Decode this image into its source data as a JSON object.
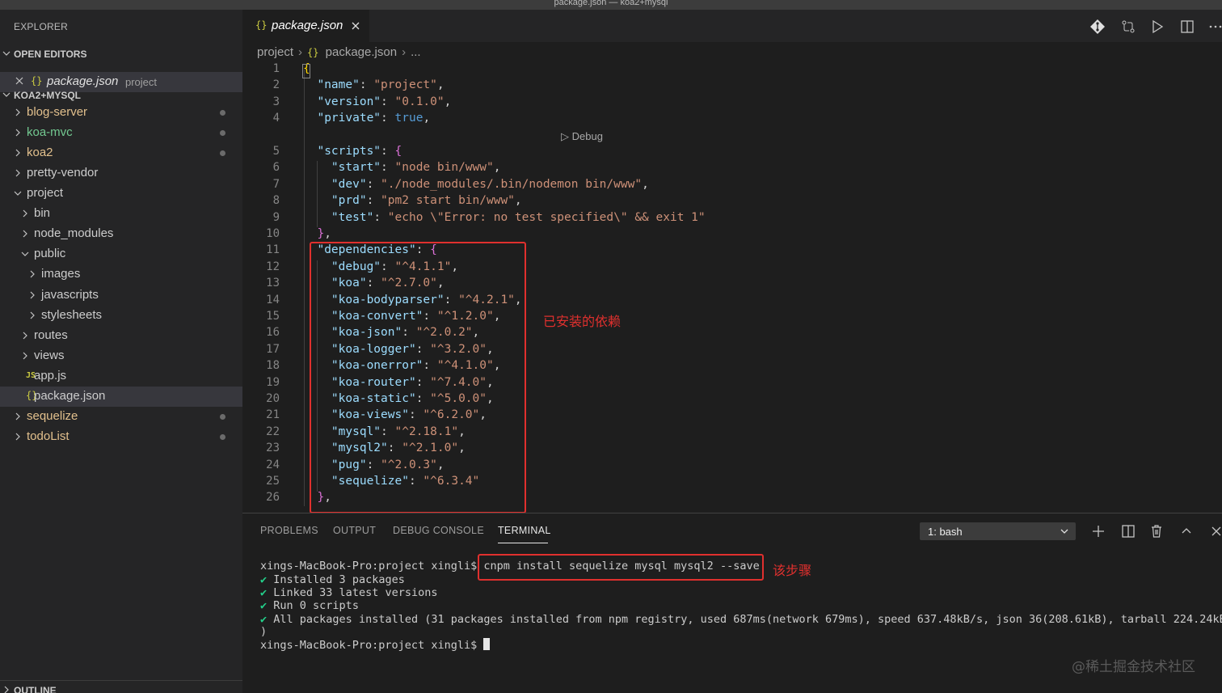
{
  "window": {
    "title": "package.json — koa2+mysql"
  },
  "sidebar": {
    "header": "EXPLORER",
    "open_editors": {
      "title": "OPEN EDITORS",
      "items": [
        {
          "name": "package.json",
          "description": "project"
        }
      ]
    },
    "workspace": {
      "title": "KOA2+MYSQL",
      "items": [
        {
          "label": "blog-server",
          "color": "#e2c08d",
          "modified": true
        },
        {
          "label": "koa-mvc",
          "color": "#73c991",
          "modified": true
        },
        {
          "label": "koa2",
          "color": "#e2c08d",
          "modified": true
        },
        {
          "label": "pretty-vendor",
          "color": "#cccccc"
        },
        {
          "label": "project",
          "color": "#cccccc",
          "expanded": true
        },
        {
          "label": "bin",
          "color": "#cccccc"
        },
        {
          "label": "node_modules",
          "color": "#cccccc"
        },
        {
          "label": "public",
          "color": "#cccccc",
          "expanded": true
        },
        {
          "label": "images",
          "color": "#cccccc"
        },
        {
          "label": "javascripts",
          "color": "#cccccc"
        },
        {
          "label": "stylesheets",
          "color": "#cccccc"
        },
        {
          "label": "routes",
          "color": "#cccccc"
        },
        {
          "label": "views",
          "color": "#cccccc"
        },
        {
          "label": "app.js",
          "color": "#cccccc",
          "icon": "JS"
        },
        {
          "label": "package.json",
          "color": "#cccccc",
          "icon": "{}",
          "selected": true
        },
        {
          "label": "sequelize",
          "color": "#e2c08d",
          "modified": true
        },
        {
          "label": "todoList",
          "color": "#e2c08d",
          "modified": true
        }
      ]
    },
    "outline": "OUTLINE"
  },
  "editor": {
    "tab": {
      "icon": "{}",
      "label": "package.json"
    },
    "breadcrumb": {
      "folder": "project",
      "icon": "{}",
      "file": "package.json",
      "more": "..."
    },
    "codelens": "Debug",
    "lines": [
      {
        "n": "1"
      },
      {
        "n": "2"
      },
      {
        "n": "3"
      },
      {
        "n": "4"
      },
      {
        "n": "5"
      },
      {
        "n": "6"
      },
      {
        "n": "7"
      },
      {
        "n": "8"
      },
      {
        "n": "9"
      },
      {
        "n": "10"
      },
      {
        "n": "11"
      },
      {
        "n": "12"
      },
      {
        "n": "13"
      },
      {
        "n": "14"
      },
      {
        "n": "15"
      },
      {
        "n": "16"
      },
      {
        "n": "17"
      },
      {
        "n": "18"
      },
      {
        "n": "19"
      },
      {
        "n": "20"
      },
      {
        "n": "21"
      },
      {
        "n": "22"
      },
      {
        "n": "23"
      },
      {
        "n": "24"
      },
      {
        "n": "25"
      },
      {
        "n": "26"
      }
    ],
    "fields": {
      "name": "\"project\"",
      "version": "\"0.1.0\"",
      "private": "true",
      "start": "\"node bin/www\"",
      "dev": "\"./node_modules/.bin/nodemon bin/www\"",
      "prd": "\"pm2 start bin/www\"",
      "test": "\"echo \\\"Error: no test specified\\\" && exit 1\""
    },
    "dependencies": [
      {
        "key": "\"debug\"",
        "value": "\"^4.1.1\""
      },
      {
        "key": "\"koa\"",
        "value": "\"^2.7.0\""
      },
      {
        "key": "\"koa-bodyparser\"",
        "value": "\"^4.2.1\""
      },
      {
        "key": "\"koa-convert\"",
        "value": "\"^1.2.0\""
      },
      {
        "key": "\"koa-json\"",
        "value": "\"^2.0.2\""
      },
      {
        "key": "\"koa-logger\"",
        "value": "\"^3.2.0\""
      },
      {
        "key": "\"koa-onerror\"",
        "value": "\"^4.1.0\""
      },
      {
        "key": "\"koa-router\"",
        "value": "\"^7.4.0\""
      },
      {
        "key": "\"koa-static\"",
        "value": "\"^5.0.0\""
      },
      {
        "key": "\"koa-views\"",
        "value": "\"^6.2.0\""
      },
      {
        "key": "\"mysql\"",
        "value": "\"^2.18.1\""
      },
      {
        "key": "\"mysql2\"",
        "value": "\"^2.1.0\""
      },
      {
        "key": "\"pug\"",
        "value": "\"^2.0.3\""
      },
      {
        "key": "\"sequelize\"",
        "value": "\"^6.3.4\""
      }
    ],
    "annotation": "已安装的依赖"
  },
  "panel": {
    "tabs": [
      "PROBLEMS",
      "OUTPUT",
      "DEBUG CONSOLE",
      "TERMINAL"
    ],
    "active_tab": "TERMINAL",
    "shell_select": "1: bash",
    "terminal": {
      "prompt": "xings-MacBook-Pro:project xingli$ ",
      "command": "cnpm install sequelize mysql mysql2 --save",
      "annotation": "该步骤",
      "check": "✔",
      "output": [
        "Installed 3 packages",
        "Linked 33 latest versions",
        "Run 0 scripts",
        "All packages installed (31 packages installed from npm registry, used 687ms(network 679ms), speed 637.48kB/s, json 36(208.61kB), tarball 224.24kB"
      ],
      "closing": ")",
      "last_prompt": "xings-MacBook-Pro:project xingli$ "
    }
  },
  "watermark": "@稀土掘金技术社区",
  "colors": {
    "accent_red": "#e0302e",
    "modified_yellow": "#e2c08d",
    "untracked_green": "#73c991"
  }
}
